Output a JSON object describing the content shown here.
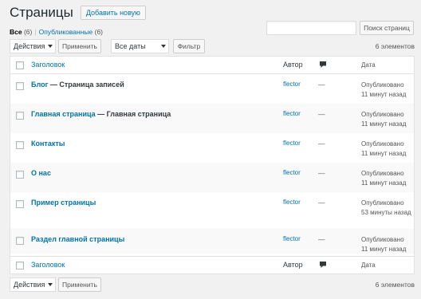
{
  "header": {
    "title": "Страницы",
    "add_new": "Добавить новую"
  },
  "filters": {
    "all_label": "Все",
    "all_count": "(6)",
    "published_label": "Опубликованные",
    "published_count": "(6)"
  },
  "search": {
    "button": "Поиск страниц",
    "value": ""
  },
  "tablenav_top": {
    "bulk_action": "Действия",
    "apply": "Применить",
    "dates": "Все даты",
    "filter": "Фильтр",
    "count": "6 элементов"
  },
  "tablenav_bottom": {
    "bulk_action": "Действия",
    "apply": "Применить",
    "count": "6 элементов"
  },
  "columns": {
    "title": "Заголовок",
    "author": "Автор",
    "date": "Дата"
  },
  "rows": [
    {
      "title": "Блог",
      "suffix": " — Страница записей",
      "author": "flector",
      "comments": "—",
      "status": "Опубликовано",
      "when": "11 минут назад"
    },
    {
      "title": "Главная страница",
      "suffix": " — Главная страница",
      "author": "flector",
      "comments": "—",
      "status": "Опубликовано",
      "when": "11 минут назад"
    },
    {
      "title": "Контакты",
      "suffix": "",
      "author": "flector",
      "comments": "—",
      "status": "Опубликовано",
      "when": "11 минут назад"
    },
    {
      "title": "О нас",
      "suffix": "",
      "author": "flector",
      "comments": "—",
      "status": "Опубликовано",
      "when": "11 минут назад"
    },
    {
      "title": "Пример страницы",
      "suffix": "",
      "author": "flector",
      "comments": "—",
      "status": "Опубликовано",
      "when": "53 минуты назад"
    },
    {
      "title": "Раздел главной страницы",
      "suffix": "",
      "author": "flector",
      "comments": "—",
      "status": "Опубликовано",
      "when": "11 минут назад"
    }
  ]
}
